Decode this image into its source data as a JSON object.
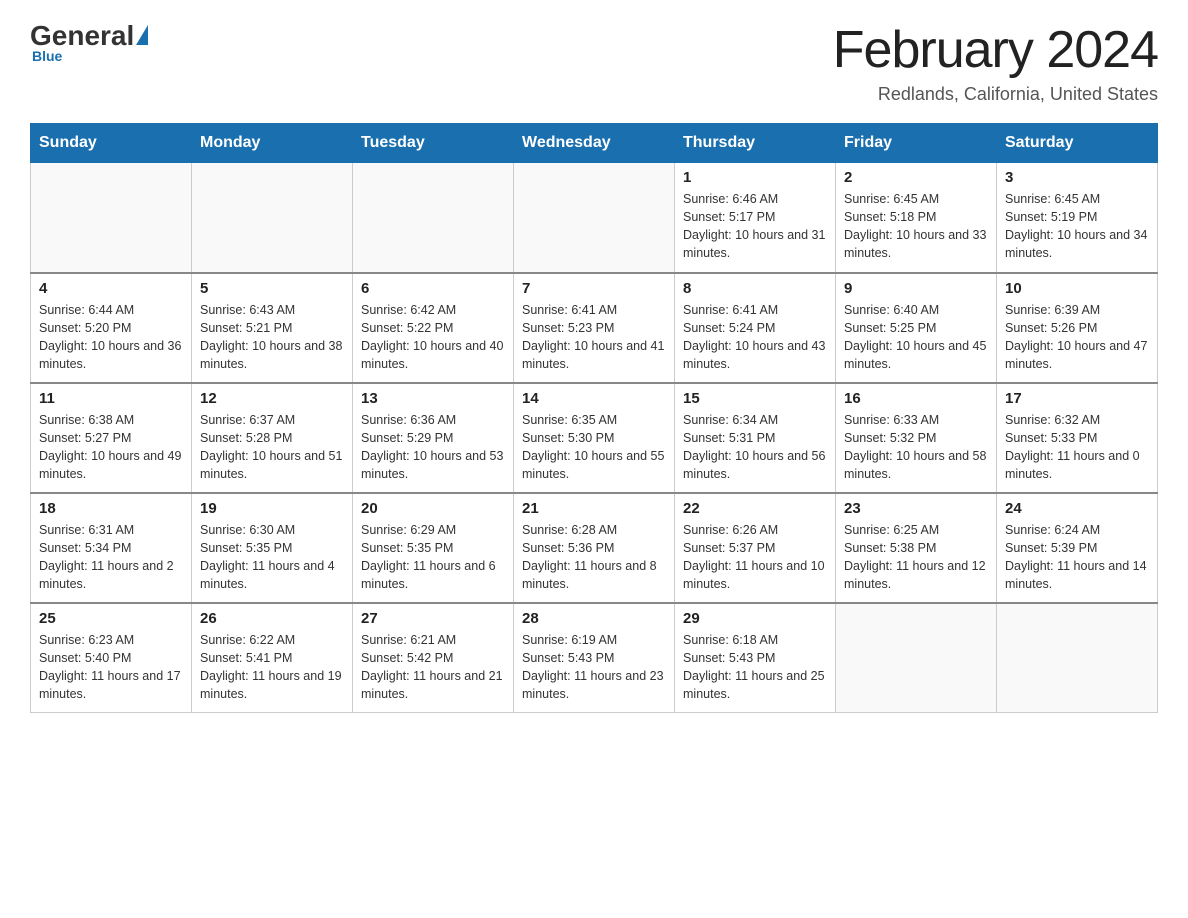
{
  "header": {
    "logo_general": "General",
    "logo_blue": "Blue",
    "month_title": "February 2024",
    "location": "Redlands, California, United States"
  },
  "days_of_week": [
    "Sunday",
    "Monday",
    "Tuesday",
    "Wednesday",
    "Thursday",
    "Friday",
    "Saturday"
  ],
  "weeks": [
    {
      "days": [
        {
          "number": "",
          "info": ""
        },
        {
          "number": "",
          "info": ""
        },
        {
          "number": "",
          "info": ""
        },
        {
          "number": "",
          "info": ""
        },
        {
          "number": "1",
          "info": "Sunrise: 6:46 AM\nSunset: 5:17 PM\nDaylight: 10 hours and 31 minutes."
        },
        {
          "number": "2",
          "info": "Sunrise: 6:45 AM\nSunset: 5:18 PM\nDaylight: 10 hours and 33 minutes."
        },
        {
          "number": "3",
          "info": "Sunrise: 6:45 AM\nSunset: 5:19 PM\nDaylight: 10 hours and 34 minutes."
        }
      ]
    },
    {
      "days": [
        {
          "number": "4",
          "info": "Sunrise: 6:44 AM\nSunset: 5:20 PM\nDaylight: 10 hours and 36 minutes."
        },
        {
          "number": "5",
          "info": "Sunrise: 6:43 AM\nSunset: 5:21 PM\nDaylight: 10 hours and 38 minutes."
        },
        {
          "number": "6",
          "info": "Sunrise: 6:42 AM\nSunset: 5:22 PM\nDaylight: 10 hours and 40 minutes."
        },
        {
          "number": "7",
          "info": "Sunrise: 6:41 AM\nSunset: 5:23 PM\nDaylight: 10 hours and 41 minutes."
        },
        {
          "number": "8",
          "info": "Sunrise: 6:41 AM\nSunset: 5:24 PM\nDaylight: 10 hours and 43 minutes."
        },
        {
          "number": "9",
          "info": "Sunrise: 6:40 AM\nSunset: 5:25 PM\nDaylight: 10 hours and 45 minutes."
        },
        {
          "number": "10",
          "info": "Sunrise: 6:39 AM\nSunset: 5:26 PM\nDaylight: 10 hours and 47 minutes."
        }
      ]
    },
    {
      "days": [
        {
          "number": "11",
          "info": "Sunrise: 6:38 AM\nSunset: 5:27 PM\nDaylight: 10 hours and 49 minutes."
        },
        {
          "number": "12",
          "info": "Sunrise: 6:37 AM\nSunset: 5:28 PM\nDaylight: 10 hours and 51 minutes."
        },
        {
          "number": "13",
          "info": "Sunrise: 6:36 AM\nSunset: 5:29 PM\nDaylight: 10 hours and 53 minutes."
        },
        {
          "number": "14",
          "info": "Sunrise: 6:35 AM\nSunset: 5:30 PM\nDaylight: 10 hours and 55 minutes."
        },
        {
          "number": "15",
          "info": "Sunrise: 6:34 AM\nSunset: 5:31 PM\nDaylight: 10 hours and 56 minutes."
        },
        {
          "number": "16",
          "info": "Sunrise: 6:33 AM\nSunset: 5:32 PM\nDaylight: 10 hours and 58 minutes."
        },
        {
          "number": "17",
          "info": "Sunrise: 6:32 AM\nSunset: 5:33 PM\nDaylight: 11 hours and 0 minutes."
        }
      ]
    },
    {
      "days": [
        {
          "number": "18",
          "info": "Sunrise: 6:31 AM\nSunset: 5:34 PM\nDaylight: 11 hours and 2 minutes."
        },
        {
          "number": "19",
          "info": "Sunrise: 6:30 AM\nSunset: 5:35 PM\nDaylight: 11 hours and 4 minutes."
        },
        {
          "number": "20",
          "info": "Sunrise: 6:29 AM\nSunset: 5:35 PM\nDaylight: 11 hours and 6 minutes."
        },
        {
          "number": "21",
          "info": "Sunrise: 6:28 AM\nSunset: 5:36 PM\nDaylight: 11 hours and 8 minutes."
        },
        {
          "number": "22",
          "info": "Sunrise: 6:26 AM\nSunset: 5:37 PM\nDaylight: 11 hours and 10 minutes."
        },
        {
          "number": "23",
          "info": "Sunrise: 6:25 AM\nSunset: 5:38 PM\nDaylight: 11 hours and 12 minutes."
        },
        {
          "number": "24",
          "info": "Sunrise: 6:24 AM\nSunset: 5:39 PM\nDaylight: 11 hours and 14 minutes."
        }
      ]
    },
    {
      "days": [
        {
          "number": "25",
          "info": "Sunrise: 6:23 AM\nSunset: 5:40 PM\nDaylight: 11 hours and 17 minutes."
        },
        {
          "number": "26",
          "info": "Sunrise: 6:22 AM\nSunset: 5:41 PM\nDaylight: 11 hours and 19 minutes."
        },
        {
          "number": "27",
          "info": "Sunrise: 6:21 AM\nSunset: 5:42 PM\nDaylight: 11 hours and 21 minutes."
        },
        {
          "number": "28",
          "info": "Sunrise: 6:19 AM\nSunset: 5:43 PM\nDaylight: 11 hours and 23 minutes."
        },
        {
          "number": "29",
          "info": "Sunrise: 6:18 AM\nSunset: 5:43 PM\nDaylight: 11 hours and 25 minutes."
        },
        {
          "number": "",
          "info": ""
        },
        {
          "number": "",
          "info": ""
        }
      ]
    }
  ]
}
